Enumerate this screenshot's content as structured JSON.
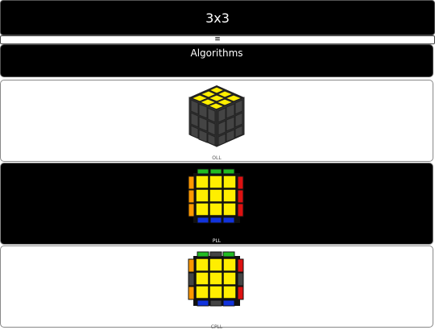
{
  "header": {
    "title": "3x3"
  },
  "menu": {
    "icon": "menu-icon",
    "glyph": "≡"
  },
  "section": {
    "title": "Algorithms"
  },
  "cards": [
    {
      "label": "OLL",
      "icon": "cube-3d-yellow-top-icon"
    },
    {
      "label": "PLL",
      "icon": "cube-top-view-pll-icon"
    },
    {
      "label": "CPLL",
      "icon": "cube-top-view-cpll-icon"
    }
  ],
  "colors": {
    "yellow": "#ffee00",
    "green": "#22bb22",
    "blue": "#1133dd",
    "red": "#dd1111",
    "orange": "#ff9900",
    "dark_sticker": "#444444"
  }
}
